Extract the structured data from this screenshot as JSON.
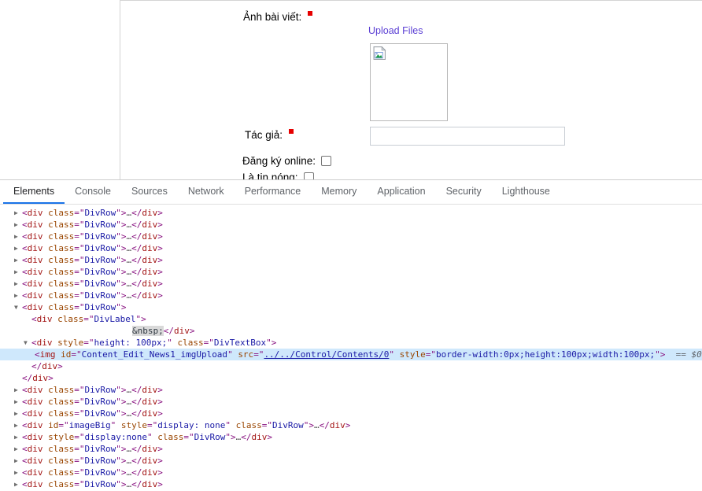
{
  "webpage": {
    "fields": [
      {
        "label": "Ảnh bài viết:",
        "required": true
      },
      {
        "label": "Tác giả:",
        "required": true
      },
      {
        "label": "Đăng ký online:",
        "required": false
      },
      {
        "label": "Là tin nóng:",
        "required": false
      }
    ],
    "upload_link_label": "Upload Files",
    "author_value": "",
    "author_placeholder": "",
    "broken_image_icon": "broken-image-icon",
    "colors": {
      "required_mark": "#e60000",
      "link": "#5b3fd4",
      "border": "#d4d4d4"
    }
  },
  "devtools": {
    "tabs": [
      {
        "label": "Elements",
        "active": true
      },
      {
        "label": "Console",
        "active": false
      },
      {
        "label": "Sources",
        "active": false
      },
      {
        "label": "Network",
        "active": false
      },
      {
        "label": "Performance",
        "active": false
      },
      {
        "label": "Memory",
        "active": false
      },
      {
        "label": "Application",
        "active": false
      },
      {
        "label": "Security",
        "active": false
      },
      {
        "label": "Lighthouse",
        "active": false
      }
    ],
    "accent_color": "#1a73e8",
    "selection_color": "#cfe8fc",
    "dom": {
      "collapsed_triangle": "▶",
      "expanded_triangle": "▼",
      "ellipsis": "…",
      "tag_div": "div",
      "tag_img": "img",
      "attr_class": "class",
      "attr_id": "id",
      "attr_style": "style",
      "attr_src": "src",
      "class_divrow": "DivRow",
      "class_divlabel": "DivLabel",
      "class_divtextbox": "DivTextBox",
      "nbsp_text": "&nbsp;",
      "style_height_100": "height: 100px;",
      "id_imagebig": "imageBig",
      "style_display_none_spaced": "display: none",
      "style_display_none": "display:none",
      "img_id": "Content_Edit_News1_imgUpload",
      "img_src": "../../Control/Contents/0",
      "img_style": "border-width:0px;height:100px;width:100px;",
      "selected_marker": "== $0"
    }
  }
}
